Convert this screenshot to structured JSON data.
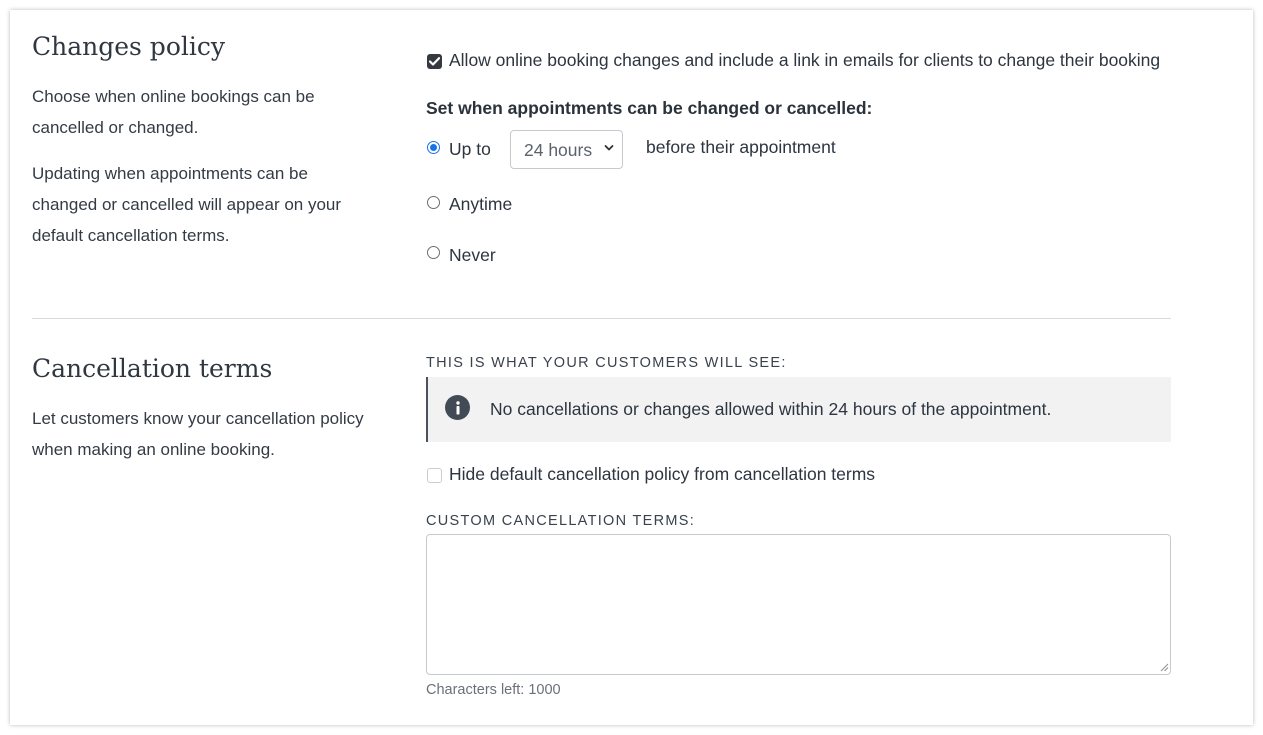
{
  "changes_policy": {
    "title": "Changes policy",
    "desc1": "Choose when online bookings can be cancelled or changed.",
    "desc2": "Updating when appointments can be changed or cancelled will appear on your default cancellation terms.",
    "allow_checkbox": {
      "label": "Allow online booking changes and include a link in emails for clients to change their booking",
      "checked": true
    },
    "set_when_label": "Set when appointments can be changed or cancelled:",
    "options": [
      {
        "label": "Up to",
        "selected": true
      },
      {
        "label": "Anytime",
        "selected": false
      },
      {
        "label": "Never",
        "selected": false
      }
    ],
    "hours_select": {
      "value": "24 hours"
    },
    "after_select_text": "before their appointment"
  },
  "cancellation_terms": {
    "title": "Cancellation terms",
    "desc": "Let customers know your cancellation policy when making an online booking.",
    "preview_label": "THIS IS WHAT YOUR CUSTOMERS WILL SEE:",
    "notice_text": "No cancellations or changes allowed within 24 hours of the appointment.",
    "hide_checkbox": {
      "label": "Hide default cancellation policy from cancellation terms",
      "checked": false
    },
    "custom_label": "CUSTOM CANCELLATION TERMS:",
    "custom_value": "",
    "chars_left": "Characters left: 1000"
  },
  "colors": {
    "checkbox_fill": "#343a40",
    "radio_accent": "#1a73e8",
    "notice_bg": "#f2f2f2",
    "info_icon": "#414a55"
  },
  "icons": [
    "checkmark-icon",
    "chevron-down-icon",
    "info-icon",
    "resize-grip-icon"
  ]
}
